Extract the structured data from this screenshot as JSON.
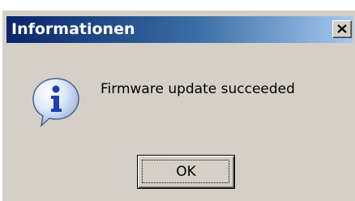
{
  "window": {
    "title": "Informationen",
    "titlebar_color_start": "#0a246a",
    "titlebar_color_end": "#a6caf0",
    "face_color": "#d4d0c8"
  },
  "icons": {
    "close": "close-icon",
    "message": "information-icon"
  },
  "dialog": {
    "message": "Firmware update succeeded",
    "ok_label": "OK"
  }
}
